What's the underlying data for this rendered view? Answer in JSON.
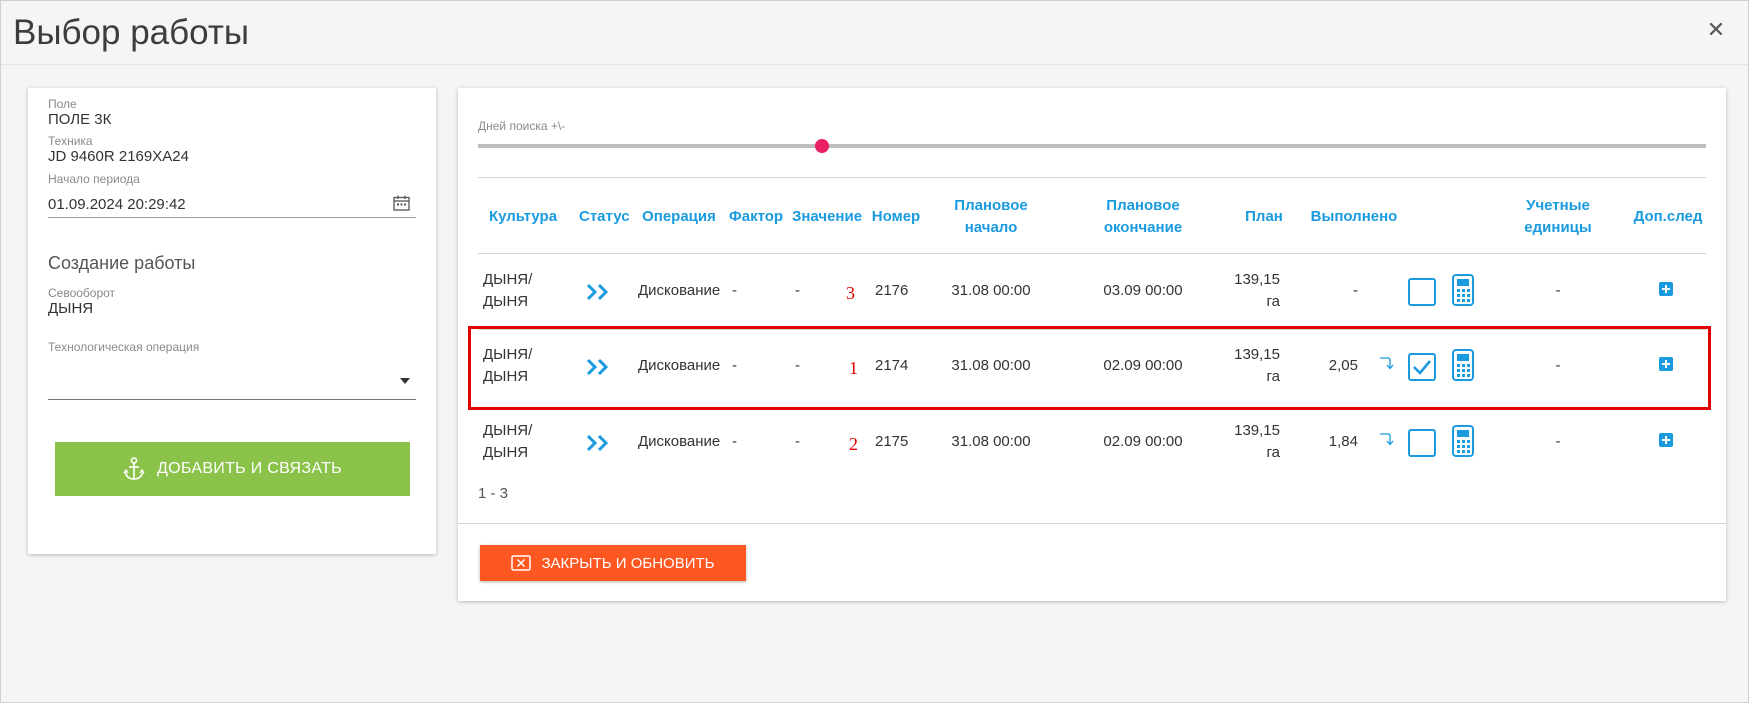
{
  "dialog": {
    "title": "Выбор работы"
  },
  "left": {
    "field_label": "Поле",
    "field_value": "ПОЛЕ 3К",
    "machine_label": "Техника",
    "machine_value": "JD 9460R 2169ХА24",
    "period_label": "Начало периода",
    "period_value": "01.09.2024 20:29:42",
    "section_title": "Создание работы",
    "rotation_label": "Севооборот",
    "rotation_value": "ДЫНЯ",
    "operation_label": "Технологическая операция",
    "operation_value": "",
    "add_button": "ДОБАВИТЬ И СВЯЗАТЬ"
  },
  "right": {
    "slider_label": "Дней поиска +\\-",
    "slider_fraction": 0.28,
    "headers": {
      "culture": "Культура",
      "status": "Статус",
      "operation": "Операция",
      "factor": "Фактор",
      "value": "Значение",
      "number": "Номер",
      "plan_start_1": "Плановое",
      "plan_start_2": "начало",
      "plan_end_1": "Плановое",
      "plan_end_2": "окончание",
      "plan": "План",
      "done": "Выполнено",
      "units_1": "Учетные",
      "units_2": "единицы",
      "extra": "Доп.след"
    },
    "rows": [
      {
        "culture_1": "ДЫНЯ/",
        "culture_2": "ДЫНЯ",
        "operation": "Дискование",
        "factor": "-",
        "value": "-",
        "marker": "3",
        "number": "2176",
        "start": "31.08 00:00",
        "end": "03.09 00:00",
        "plan_1": "139,15",
        "plan_2": "га",
        "done": "-",
        "checked": false,
        "units": "-"
      },
      {
        "culture_1": "ДЫНЯ/",
        "culture_2": "ДЫНЯ",
        "operation": "Дискование",
        "factor": "-",
        "value": "-",
        "marker": "1",
        "number": "2174",
        "start": "31.08 00:00",
        "end": "02.09 00:00",
        "plan_1": "139,15",
        "plan_2": "га",
        "done": "2,05",
        "checked": true,
        "units": "-"
      },
      {
        "culture_1": "ДЫНЯ/",
        "culture_2": "ДЫНЯ",
        "operation": "Дискование",
        "factor": "-",
        "value": "-",
        "marker": "2",
        "number": "2175",
        "start": "31.08 00:00",
        "end": "02.09 00:00",
        "plan_1": "139,15",
        "plan_2": "га",
        "done": "1,84",
        "checked": false,
        "units": "-"
      }
    ],
    "pager": "1 - 3",
    "close_button": "ЗАКРЫТЬ И ОБНОВИТЬ"
  },
  "colors": {
    "accent": "#1a9be0",
    "green": "#8bc34a",
    "orange": "#ff5722",
    "pink": "#e91e63",
    "highlight": "#e00000"
  }
}
